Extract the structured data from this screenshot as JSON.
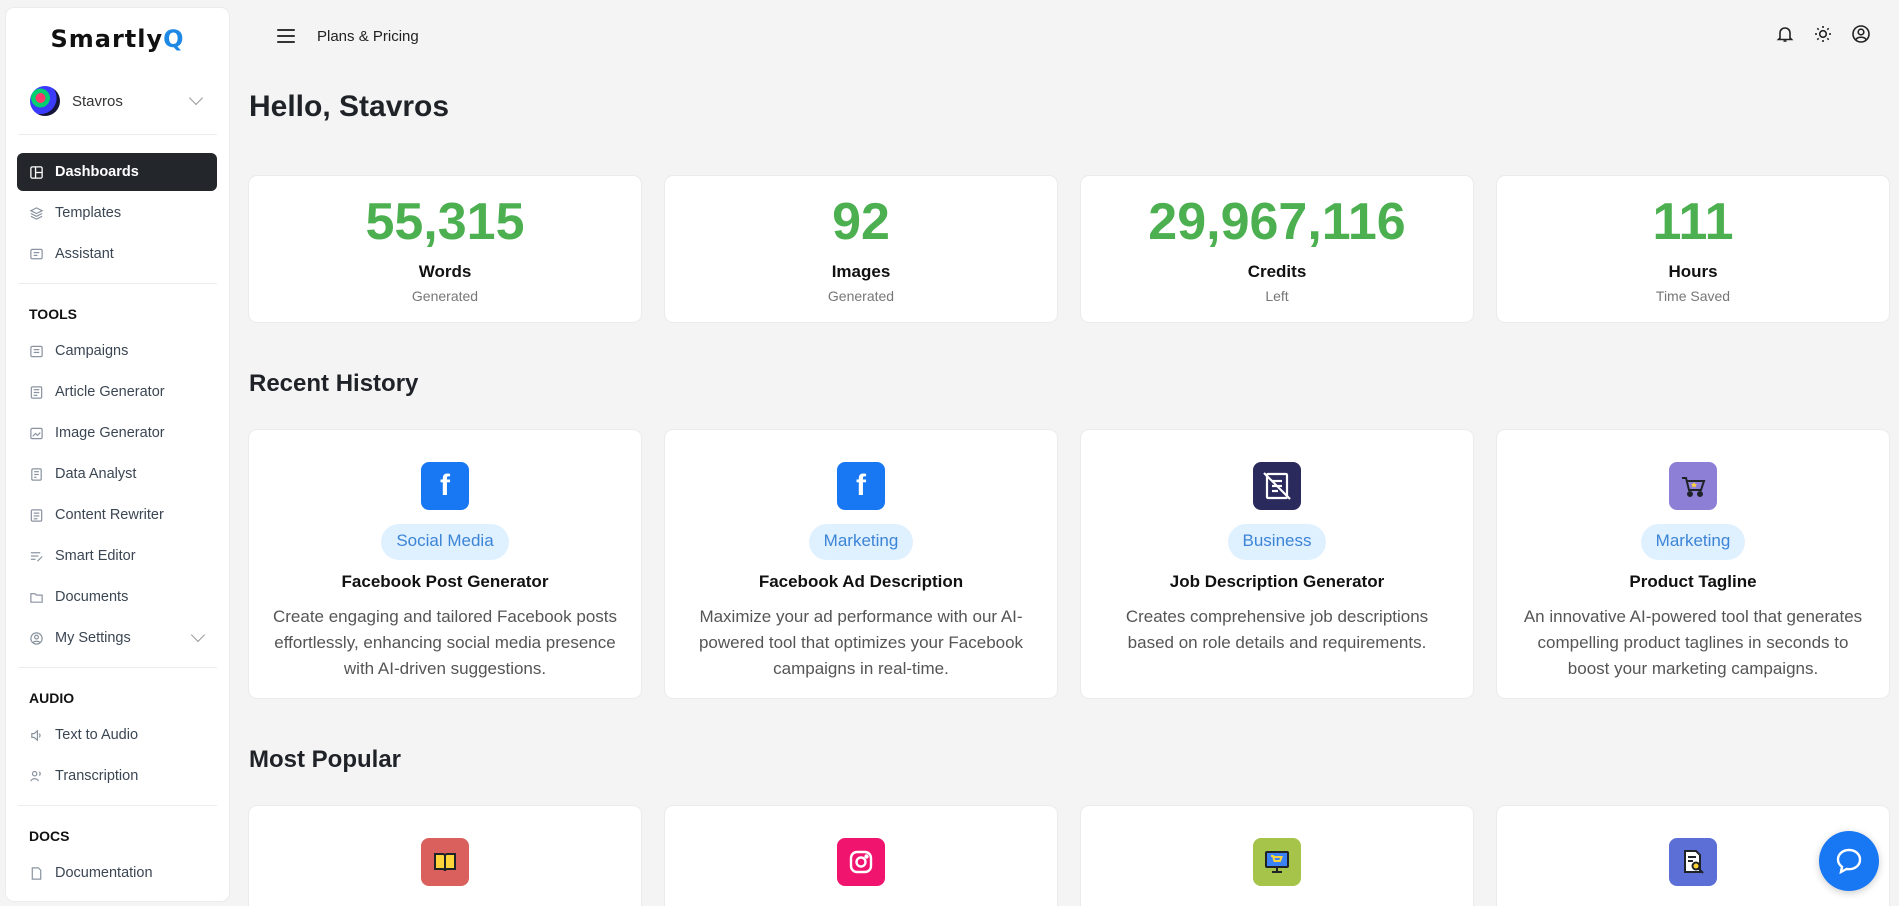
{
  "sidebar": {
    "logo_main": "Smartly",
    "logo_accent": "Q",
    "user_name": "Stavros",
    "items": [
      {
        "label": "Dashboards",
        "icon": "dashboard-icon",
        "active": true
      },
      {
        "label": "Templates",
        "icon": "layers-icon"
      },
      {
        "label": "Assistant",
        "icon": "chat-icon"
      }
    ],
    "tools_title": "TOOLS",
    "tools": [
      {
        "label": "Campaigns",
        "icon": "campaign-icon"
      },
      {
        "label": "Article Generator",
        "icon": "article-icon"
      },
      {
        "label": "Image Generator",
        "icon": "image-icon"
      },
      {
        "label": "Data Analyst",
        "icon": "data-icon"
      },
      {
        "label": "Content Rewriter",
        "icon": "rewrite-icon"
      },
      {
        "label": "Smart Editor",
        "icon": "editor-icon"
      },
      {
        "label": "Documents",
        "icon": "folder-icon"
      },
      {
        "label": "My Settings",
        "icon": "user-settings-icon"
      }
    ],
    "audio_title": "AUDIO",
    "audio": [
      {
        "label": "Text to Audio",
        "icon": "speaker-icon"
      },
      {
        "label": "Transcription",
        "icon": "transcription-icon"
      }
    ],
    "docs_title": "DOCS",
    "docs": [
      {
        "label": "Documentation",
        "icon": "document-icon"
      }
    ]
  },
  "header": {
    "breadcrumb": "Plans & Pricing"
  },
  "main": {
    "greeting": "Hello, Stavros",
    "stats": [
      {
        "value": "55,315",
        "label": "Words",
        "sub": "Generated"
      },
      {
        "value": "92",
        "label": "Images",
        "sub": "Generated"
      },
      {
        "value": "29,967,116",
        "label": "Credits",
        "sub": "Left"
      },
      {
        "value": "111",
        "label": "Hours",
        "sub": "Time Saved"
      }
    ],
    "recent_title": "Recent History",
    "recent": [
      {
        "icon": "facebook-icon",
        "icon_color": "#1877f2",
        "tag": "Social Media",
        "title": "Facebook Post Generator",
        "desc": "Create engaging and tailored Facebook posts effortlessly, enhancing social media presence with AI-driven suggestions."
      },
      {
        "icon": "facebook-icon",
        "icon_color": "#1877f2",
        "tag": "Marketing",
        "title": "Facebook Ad Description",
        "desc": "Maximize your ad performance with our AI-powered tool that optimizes your Facebook campaigns in real-time."
      },
      {
        "icon": "job-description-icon",
        "icon_color": "#2b2a5c",
        "tag": "Business",
        "title": "Job Description Generator",
        "desc": "Creates comprehensive job descriptions based on role details and requirements."
      },
      {
        "icon": "cart-icon",
        "icon_color": "#8e7fd6",
        "tag": "Marketing",
        "title": "Product Tagline",
        "desc": "An innovative AI-powered tool that generates compelling product taglines in seconds to boost your marketing campaigns."
      }
    ],
    "popular_title": "Most Popular",
    "popular": [
      {
        "icon": "book-icon",
        "icon_color": "#d9605c"
      },
      {
        "icon": "instagram-icon",
        "icon_color": "#f0146e"
      },
      {
        "icon": "monitor-cart-icon",
        "icon_color": "#a6c34a"
      },
      {
        "icon": "document-search-icon",
        "icon_color": "#5b6fd6"
      }
    ]
  }
}
